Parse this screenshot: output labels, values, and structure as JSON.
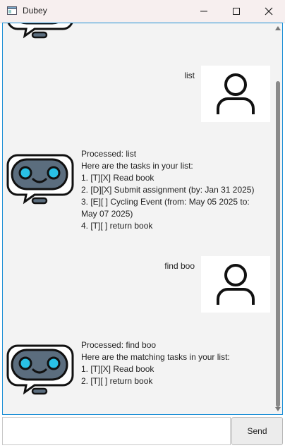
{
  "window": {
    "title": "Dubey"
  },
  "messages": {
    "user1": "list",
    "bot1": "Processed: list\nHere are the tasks in your list:\n1. [T][X] Read book\n2. [D][X] Submit assignment (by: Jan 31 2025)\n3. [E][ ] Cycling Event (from: May 05 2025 to:\nMay 07 2025)\n4. [T][ ] return book",
    "user2": "find boo",
    "bot2": "Processed: find boo\nHere are the matching tasks in your list:\n1. [T][X] Read book\n2. [T][ ] return book"
  },
  "input": {
    "value": ""
  },
  "send_label": "Send",
  "icons": {
    "app": "app-window-icon",
    "minimize": "minimize-icon",
    "maximize": "maximize-icon",
    "close": "close-icon",
    "user": "user-avatar-icon",
    "bot": "robot-avatar-icon"
  },
  "colors": {
    "accent_border": "#1e90d6",
    "bot_body": "#5b6d7e",
    "bot_eye": "#29c1e6",
    "chat_bg": "#f3f3f3"
  }
}
